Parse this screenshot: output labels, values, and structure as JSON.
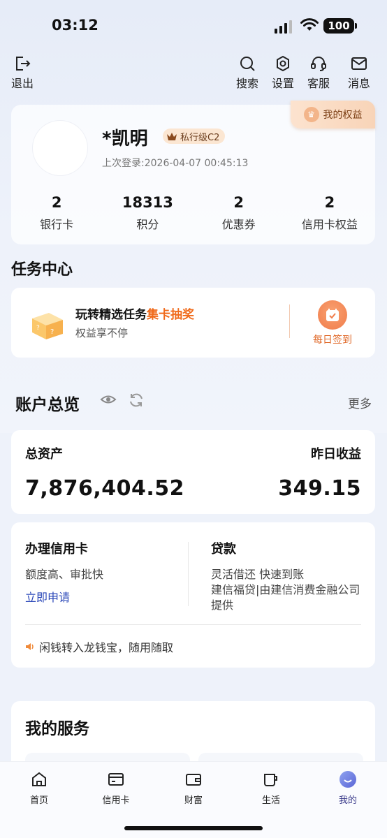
{
  "status_bar": {
    "time": "03:12",
    "battery": "100"
  },
  "top_nav": {
    "logout": "退出",
    "search": "搜索",
    "settings": "设置",
    "support": "客服",
    "messages": "消息"
  },
  "profile": {
    "name": "*凯明",
    "level": "私行级C2",
    "last_login": "上次登录:2026-04-07 00:45:13",
    "rights_label": "我的权益",
    "stats": [
      {
        "value": "2",
        "label": "银行卡"
      },
      {
        "value": "18313",
        "label": "积分"
      },
      {
        "value": "2",
        "label": "优惠券"
      },
      {
        "value": "2",
        "label": "信用卡权益"
      }
    ]
  },
  "task_center": {
    "title": "任务中心",
    "task_title_prefix": "玩转精选任务",
    "task_title_highlight": "集卡抽奖",
    "task_subtitle": "权益享不停",
    "checkin_label": "每日签到"
  },
  "account_overview": {
    "title": "账户总览",
    "more": "更多",
    "total_assets_label": "总资产",
    "total_assets_value": "7,876,404.52",
    "yesterday_income_label": "昨日收益",
    "yesterday_income_value": "349.15"
  },
  "services": {
    "credit_card_title": "办理信用卡",
    "credit_card_desc": "额度高、审批快",
    "credit_card_link": "立即申请",
    "loan_title": "贷款",
    "loan_desc_1": "灵活借还 快速到账",
    "loan_desc_2": "建信福贷|由建信消费金融公司提供",
    "notice": "闲钱转入龙钱宝，随用随取"
  },
  "my_services": {
    "title": "我的服务"
  },
  "tab_bar": {
    "items": [
      {
        "label": "首页",
        "icon": "home-icon"
      },
      {
        "label": "信用卡",
        "icon": "credit-card-icon"
      },
      {
        "label": "财富",
        "icon": "wallet-icon"
      },
      {
        "label": "生活",
        "icon": "cup-icon"
      },
      {
        "label": "我的",
        "icon": "profile-icon"
      }
    ],
    "active": "我的",
    "active_color": "#3a3a8a"
  },
  "colors": {
    "accent_orange": "#f06a1a",
    "link_blue": "#2a47b8"
  }
}
